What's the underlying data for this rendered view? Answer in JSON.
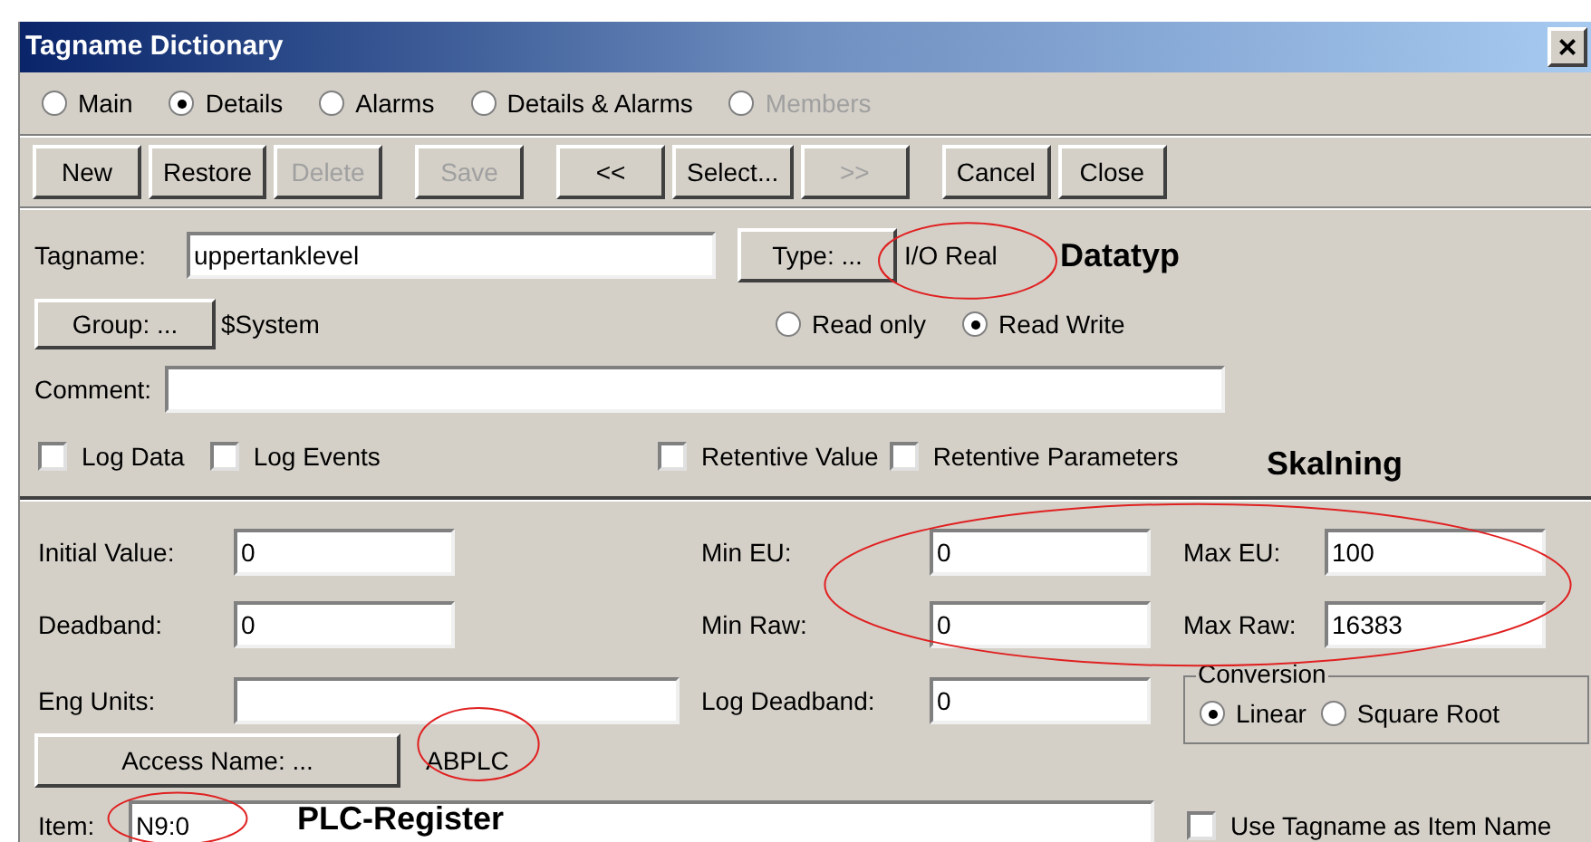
{
  "window": {
    "title": "Tagname Dictionary",
    "close": "×"
  },
  "view_options": [
    {
      "label": "Main",
      "selected": false,
      "disabled": false
    },
    {
      "label": "Details",
      "selected": true,
      "disabled": false
    },
    {
      "label": "Alarms",
      "selected": false,
      "disabled": false
    },
    {
      "label": "Details & Alarms",
      "selected": false,
      "disabled": false
    },
    {
      "label": "Members",
      "selected": false,
      "disabled": true
    }
  ],
  "button_groups": [
    {
      "buttons": [
        {
          "label": "New",
          "disabled": false
        },
        {
          "label": "Restore",
          "disabled": false
        },
        {
          "label": "Delete",
          "disabled": true
        }
      ]
    },
    {
      "buttons": [
        {
          "label": "Save",
          "disabled": true
        }
      ]
    },
    {
      "buttons": [
        {
          "label": "<<",
          "disabled": false
        },
        {
          "label": "Select...",
          "disabled": false
        },
        {
          "label": ">>",
          "disabled": true
        }
      ]
    },
    {
      "buttons": [
        {
          "label": "Cancel",
          "disabled": false
        },
        {
          "label": "Close",
          "disabled": false
        }
      ]
    }
  ],
  "tagname": {
    "label": "Tagname:",
    "value": "uppertanklevel"
  },
  "type": {
    "button": "Type: ...",
    "value": "I/O Real"
  },
  "group": {
    "button": "Group: ...",
    "value": "$System"
  },
  "access": [
    {
      "label": "Read only",
      "selected": false
    },
    {
      "label": "Read Write",
      "selected": true
    }
  ],
  "comment": {
    "label": "Comment:"
  },
  "options": [
    {
      "label": "Log Data",
      "checked": false
    },
    {
      "label": "Log Events",
      "checked": false
    },
    {
      "label": "Retentive Value",
      "checked": false
    },
    {
      "label": "Retentive Parameters",
      "checked": false
    }
  ],
  "initial_value": {
    "label": "Initial Value:",
    "value": "0"
  },
  "deadband": {
    "label": "Deadband:",
    "value": "0"
  },
  "eng_units": {
    "label": "Eng Units:"
  },
  "min_eu": {
    "label": "Min EU:",
    "value": "0"
  },
  "min_raw": {
    "label": "Min Raw:",
    "value": "0"
  },
  "log_deadband": {
    "label": "Log Deadband:",
    "value": "0"
  },
  "max_eu": {
    "label": "Max EU:",
    "value": "100"
  },
  "max_raw": {
    "label": "Max Raw:",
    "value": "16383"
  },
  "conversion": {
    "title": "Conversion",
    "options": [
      {
        "label": "Linear",
        "selected": true
      },
      {
        "label": "Square Root",
        "selected": false
      }
    ]
  },
  "access_name": {
    "button": "Access Name: ...",
    "value": "ABPLC"
  },
  "item": {
    "label": "Item:",
    "value": "N9:0",
    "use_tagname": {
      "label": "Use Tagname as Item Name",
      "checked": false
    }
  },
  "annotations": {
    "type": "Datatyp",
    "scaling": "Skalning",
    "item": "PLC-Register"
  }
}
